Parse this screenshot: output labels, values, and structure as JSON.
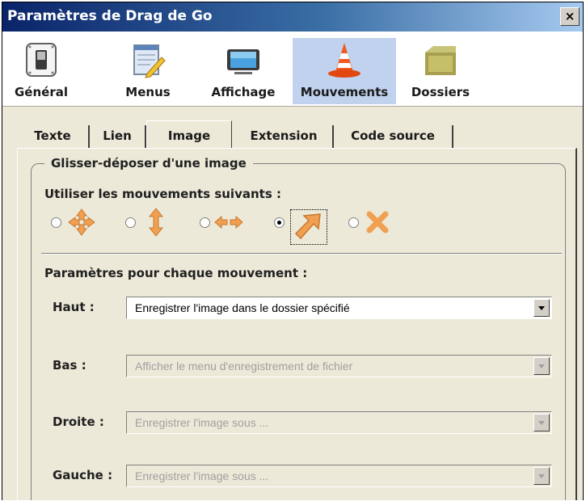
{
  "window": {
    "title": "Paramètres de Drag de Go",
    "close_label": "×"
  },
  "toolbar": {
    "items": [
      {
        "label": "Général",
        "icon": "switch-icon"
      },
      {
        "label": "Menus",
        "icon": "notepad-icon"
      },
      {
        "label": "Affichage",
        "icon": "monitor-icon"
      },
      {
        "label": "Mouvements",
        "icon": "traffic-cone-icon",
        "selected": true
      },
      {
        "label": "Dossiers",
        "icon": "folder-box-icon"
      }
    ]
  },
  "tabs": [
    {
      "label": "Texte"
    },
    {
      "label": "Lien"
    },
    {
      "label": "Image",
      "selected": true
    },
    {
      "label": "Extension"
    },
    {
      "label": "Code source"
    }
  ],
  "group": {
    "legend": "Glisser-déposer d'une image",
    "movements_label": "Utiliser les mouvements suivants :",
    "movement_options": [
      {
        "icon": "four-way-arrows-icon",
        "checked": false
      },
      {
        "icon": "up-down-arrows-icon",
        "checked": false
      },
      {
        "icon": "left-right-arrows-icon",
        "checked": false
      },
      {
        "icon": "diagonal-arrow-icon",
        "checked": true
      },
      {
        "icon": "cross-icon",
        "checked": false
      }
    ],
    "params_label": "Paramètres pour chaque mouvement :",
    "rows": [
      {
        "label": "Haut :",
        "value": "Enregistrer l'image dans le dossier spécifié",
        "enabled": true
      },
      {
        "label": "Bas :",
        "value": "Afficher le menu d'enregistrement de fichier",
        "enabled": false
      },
      {
        "label": "Droite :",
        "value": "Enregistrer l'image sous ...",
        "enabled": false
      },
      {
        "label": "Gauche :",
        "value": "Enregistrer l'image sous ...",
        "enabled": false
      }
    ]
  },
  "colors": {
    "selected_toolbar_bg": "#c1d2ee",
    "arrow_orange": "#f0a050"
  }
}
